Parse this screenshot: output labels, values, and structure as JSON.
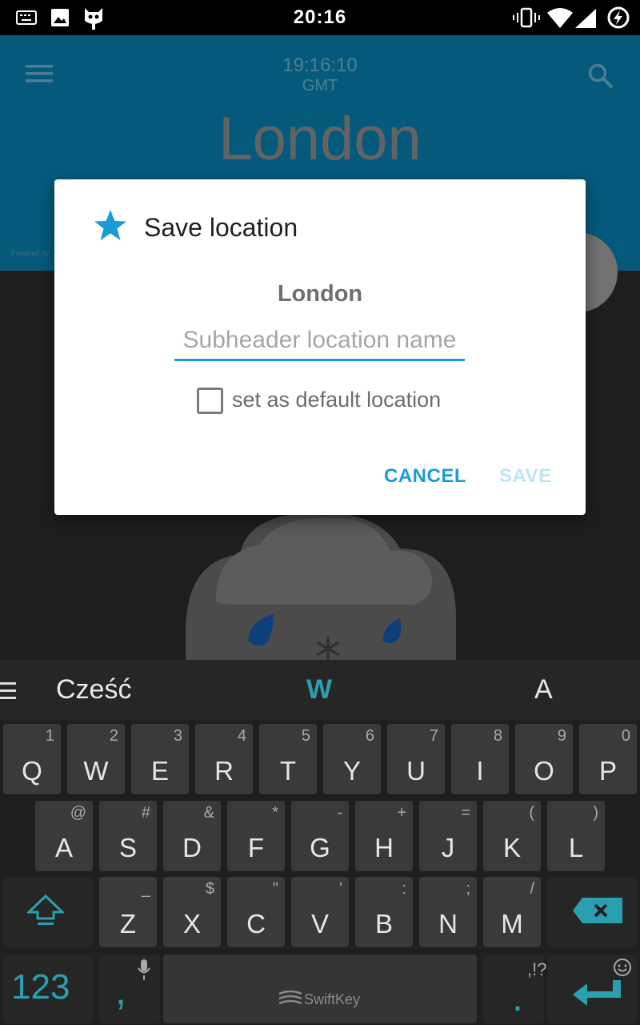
{
  "status_bar": {
    "time": "20:16",
    "left_icons": [
      "keyboard-icon",
      "image-icon",
      "cyanogen-mascot-icon"
    ],
    "right_icons": [
      "vibrate-icon",
      "wifi-icon",
      "signal-icon",
      "charging-icon"
    ]
  },
  "app": {
    "clock": "19:16:10",
    "timezone": "GMT",
    "city": "London",
    "powered_by": "Powered by"
  },
  "dialog": {
    "title": "Save location",
    "title_icon": "star-icon",
    "location_name": "London",
    "subheader_placeholder": "Subheader location name",
    "subheader_value": "",
    "checkbox_label": "set as default location",
    "checkbox_checked": false,
    "cancel_label": "CANCEL",
    "save_label": "SAVE",
    "save_enabled": false
  },
  "keyboard": {
    "suggestions": [
      "Cześć",
      "W",
      "A"
    ],
    "row1": [
      {
        "k": "Q",
        "s": "1"
      },
      {
        "k": "W",
        "s": "2"
      },
      {
        "k": "E",
        "s": "3"
      },
      {
        "k": "R",
        "s": "4"
      },
      {
        "k": "T",
        "s": "5"
      },
      {
        "k": "Y",
        "s": "6"
      },
      {
        "k": "U",
        "s": "7"
      },
      {
        "k": "I",
        "s": "8"
      },
      {
        "k": "O",
        "s": "9"
      },
      {
        "k": "P",
        "s": "0"
      }
    ],
    "row2": [
      {
        "k": "A",
        "s": "@"
      },
      {
        "k": "S",
        "s": "#"
      },
      {
        "k": "D",
        "s": "&"
      },
      {
        "k": "F",
        "s": "*"
      },
      {
        "k": "G",
        "s": "-"
      },
      {
        "k": "H",
        "s": "+"
      },
      {
        "k": "J",
        "s": "="
      },
      {
        "k": "K",
        "s": "("
      },
      {
        "k": "L",
        "s": ")"
      }
    ],
    "row3": [
      {
        "k": "Z",
        "s": "_"
      },
      {
        "k": "X",
        "s": "$"
      },
      {
        "k": "C",
        "s": "\""
      },
      {
        "k": "V",
        "s": "'"
      },
      {
        "k": "B",
        "s": ":"
      },
      {
        "k": "N",
        "s": ";"
      },
      {
        "k": "M",
        "s": "/"
      }
    ],
    "numbers_label": "123",
    "comma_label": ",",
    "period_label": ".",
    "punct_hint": ",!?",
    "space_brand": "SwiftKey",
    "accent_color": "#2a9fb0"
  }
}
